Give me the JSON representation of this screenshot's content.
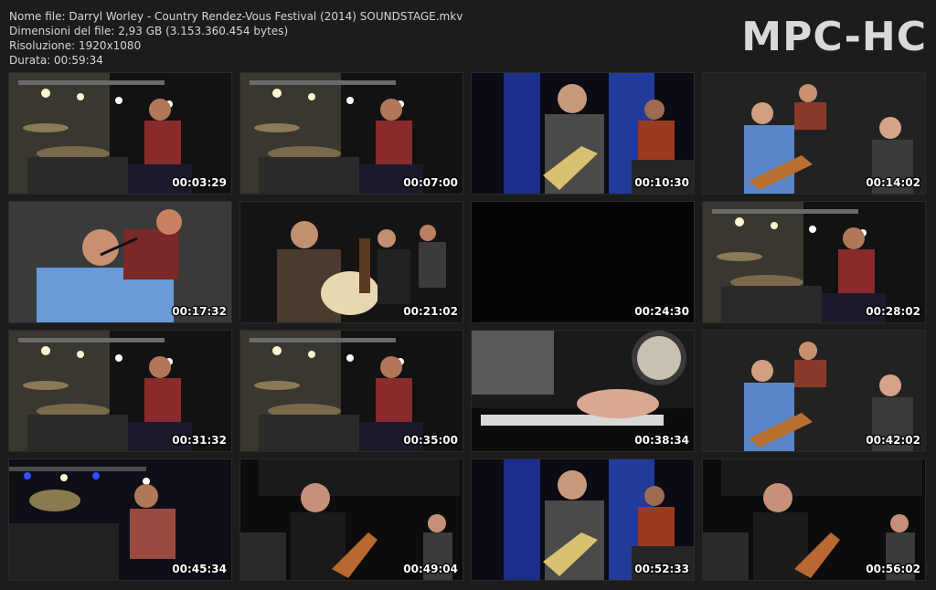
{
  "header": {
    "filename_line": "Nome file: Darryl Worley - Country Rendez-Vous Festival (2014) SOUNDSTAGE.mkv",
    "filesize_line": "Dimensioni del file: 2,93 GB (3.153.360.454 bytes)",
    "resolution_line": "Risoluzione: 1920x1080",
    "duration_line": "Durata: 00:59:34",
    "logo": "MPC-HC"
  },
  "thumbnails": [
    {
      "time": "00:03:29",
      "scene": "drummer-stage-lights"
    },
    {
      "time": "00:07:00",
      "scene": "drummer-stage-lights"
    },
    {
      "time": "00:10:30",
      "scene": "singer-guitar-blue-backdrop"
    },
    {
      "time": "00:14:02",
      "scene": "band-guitarists-led-wall"
    },
    {
      "time": "00:17:32",
      "scene": "singer-closeup-drummer"
    },
    {
      "time": "00:21:02",
      "scene": "acoustic-guitarist-band"
    },
    {
      "time": "00:24:30",
      "scene": "black-frame"
    },
    {
      "time": "00:28:02",
      "scene": "drummer-stage-lights"
    },
    {
      "time": "00:31:32",
      "scene": "drummer-stage-lights"
    },
    {
      "time": "00:35:00",
      "scene": "drummer-stage-lights"
    },
    {
      "time": "00:38:34",
      "scene": "keyboard-hands-closeup"
    },
    {
      "time": "00:42:02",
      "scene": "band-guitarists-led-wall"
    },
    {
      "time": "00:45:34",
      "scene": "drummer-blue-lights"
    },
    {
      "time": "00:49:04",
      "scene": "guitarists-dark-stage"
    },
    {
      "time": "00:52:33",
      "scene": "singer-guitar-blue-backdrop"
    },
    {
      "time": "00:56:02",
      "scene": "guitarists-dark-stage"
    }
  ]
}
